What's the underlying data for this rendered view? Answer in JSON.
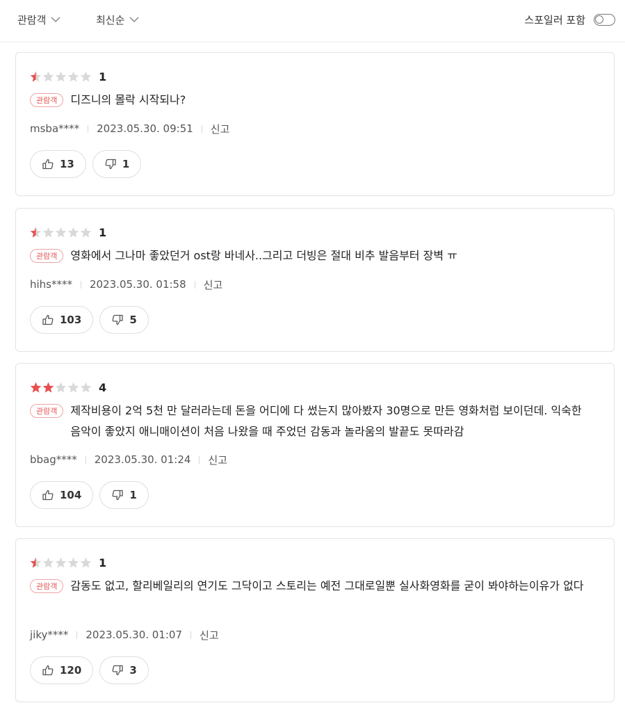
{
  "filters": {
    "audience_label": "관람객",
    "sort_label": "최신순",
    "spoiler_label": "스포일러 포함",
    "spoiler_enabled": false
  },
  "colors": {
    "star_filled": "#e94f4f",
    "star_empty": "#d9d9d9",
    "badge": "#e55454"
  },
  "reviews": [
    {
      "rating": 1,
      "score_label": "1",
      "badge": "관람객",
      "text": "디즈니의 몰락 시작되나?",
      "author": "msba****",
      "date": "2023.05.30. 09:51",
      "report": "신고",
      "likes": "13",
      "dislikes": "1"
    },
    {
      "rating": 1,
      "score_label": "1",
      "badge": "관람객",
      "text": "영화에서 그나마 좋았던거 ost랑 바네사..그리고 더빙은 절대 비추 발음부터 장벽 ㅠ",
      "author": "hihs****",
      "date": "2023.05.30. 01:58",
      "report": "신고",
      "likes": "103",
      "dislikes": "5"
    },
    {
      "rating": 4,
      "score_label": "4",
      "badge": "관람객",
      "text": "제작비용이 2억 5천 만 달러라는데 돈을 어디에 다 썼는지 많아봤자 30명으로 만든 영화처럼 보이던데. 익숙한 음악이 좋았지 애니매이션이 처음 나왔을 때 주었던 감동과 놀라움의 발끝도 못따라감",
      "author": "bbag****",
      "date": "2023.05.30. 01:24",
      "report": "신고",
      "likes": "104",
      "dislikes": "1"
    },
    {
      "rating": 1,
      "score_label": "1",
      "badge": "관람객",
      "text": "감동도 없고, 할리베일리의 연기도 그닥이고 스토리는 예전 그대로일뿐 실사화영화를 굳이 봐야하는이유가 없다",
      "author": "jiky****",
      "date": "2023.05.30. 01:07",
      "report": "신고",
      "likes": "120",
      "dislikes": "3"
    }
  ]
}
